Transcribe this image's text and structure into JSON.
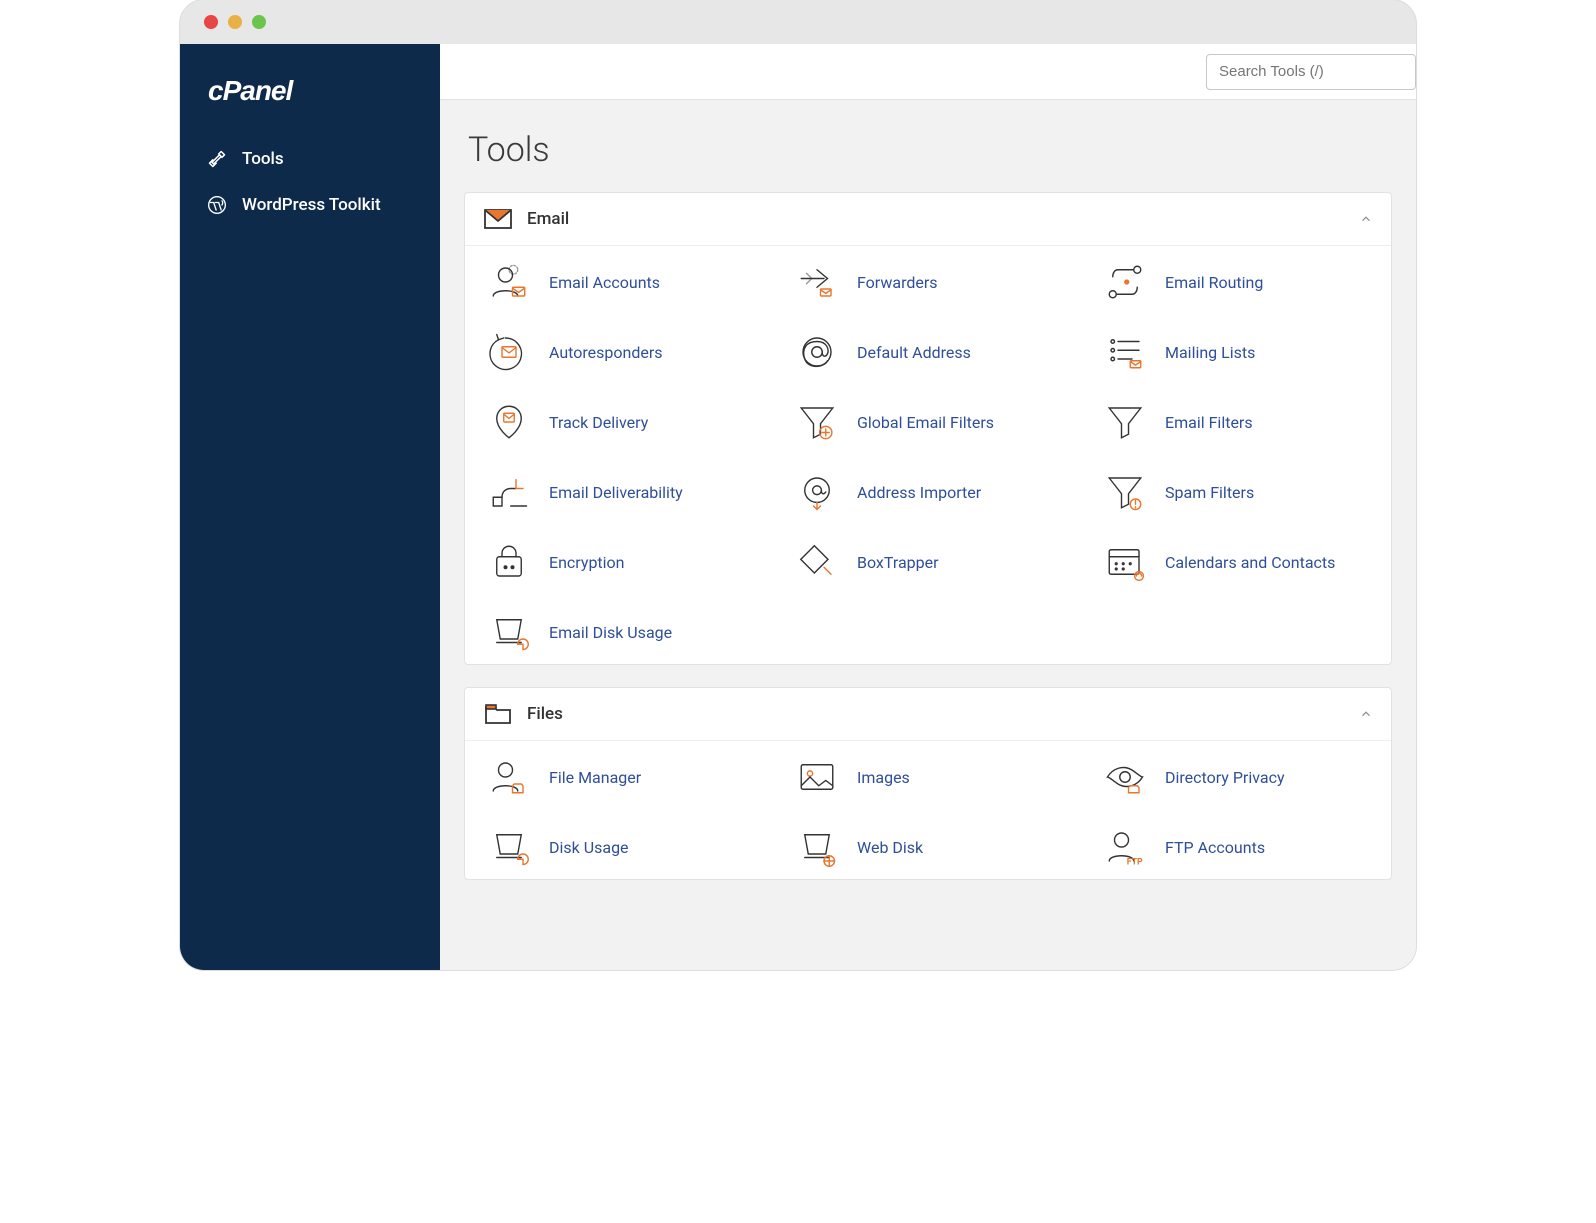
{
  "brand": "cPanel",
  "sidebar": {
    "items": [
      {
        "label": "Tools",
        "icon": "tools"
      },
      {
        "label": "WordPress Toolkit",
        "icon": "wordpress"
      }
    ]
  },
  "search": {
    "placeholder": "Search Tools (/)"
  },
  "page_title": "Tools",
  "sections": [
    {
      "id": "email",
      "title": "Email",
      "icon": "envelope",
      "tools": [
        {
          "label": "Email Accounts",
          "icon": "email-accounts"
        },
        {
          "label": "Forwarders",
          "icon": "forwarders"
        },
        {
          "label": "Email Routing",
          "icon": "email-routing"
        },
        {
          "label": "Autoresponders",
          "icon": "autoresponders"
        },
        {
          "label": "Default Address",
          "icon": "default-address"
        },
        {
          "label": "Mailing Lists",
          "icon": "mailing-lists"
        },
        {
          "label": "Track Delivery",
          "icon": "track-delivery"
        },
        {
          "label": "Global Email Filters",
          "icon": "global-email-filters"
        },
        {
          "label": "Email Filters",
          "icon": "email-filters"
        },
        {
          "label": "Email Deliverability",
          "icon": "email-deliverability"
        },
        {
          "label": "Address Importer",
          "icon": "address-importer"
        },
        {
          "label": "Spam Filters",
          "icon": "spam-filters"
        },
        {
          "label": "Encryption",
          "icon": "encryption"
        },
        {
          "label": "BoxTrapper",
          "icon": "boxtrapper"
        },
        {
          "label": "Calendars and Contacts",
          "icon": "calendars-contacts"
        },
        {
          "label": "Email Disk Usage",
          "icon": "email-disk-usage"
        }
      ]
    },
    {
      "id": "files",
      "title": "Files",
      "icon": "folder",
      "tools": [
        {
          "label": "File Manager",
          "icon": "file-manager"
        },
        {
          "label": "Images",
          "icon": "images"
        },
        {
          "label": "Directory Privacy",
          "icon": "directory-privacy"
        },
        {
          "label": "Disk Usage",
          "icon": "disk-usage"
        },
        {
          "label": "Web Disk",
          "icon": "web-disk"
        },
        {
          "label": "FTP Accounts",
          "icon": "ftp-accounts"
        }
      ]
    }
  ],
  "colors": {
    "accent": "#e8762f",
    "link": "#2f4f9a",
    "sidebar": "#0d2a4a"
  }
}
